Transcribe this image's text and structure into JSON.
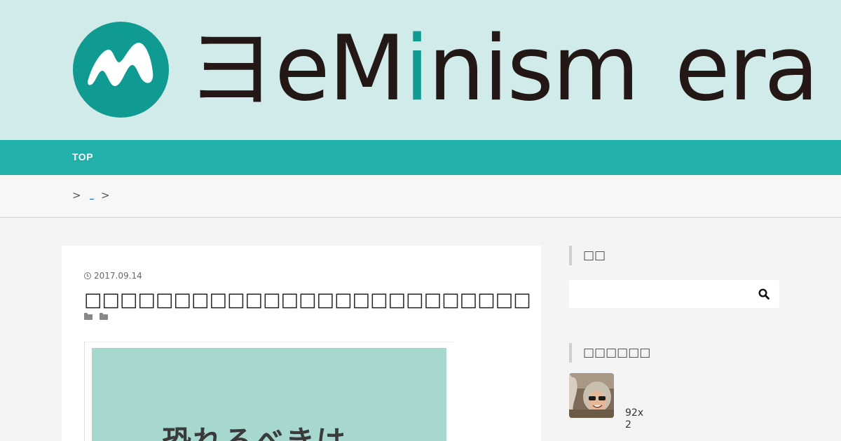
{
  "site": {
    "logo_prefix": "ヨeM",
    "logo_accent": "i",
    "logo_middle": "nism",
    "logo_suffix": "era",
    "brand_colors": {
      "teal": "#0f9a92",
      "nav": "#21b1aa",
      "header_bg": "#d1ebea",
      "text": "#231815"
    }
  },
  "nav": {
    "items": [
      {
        "label": "TOP"
      }
    ]
  },
  "breadcrumb": {
    "separator": ">"
  },
  "article": {
    "date": "2017.09.14",
    "title": "□□□□□□□□□□□□□□□□□□□□□□□□□□□□□□□",
    "eyecatch_text": "恐れるべきは"
  },
  "sidebar": {
    "search": {
      "title": "□□",
      "placeholder": ""
    },
    "profile": {
      "title": "□□□□□□",
      "caption": "92x\n2"
    }
  }
}
